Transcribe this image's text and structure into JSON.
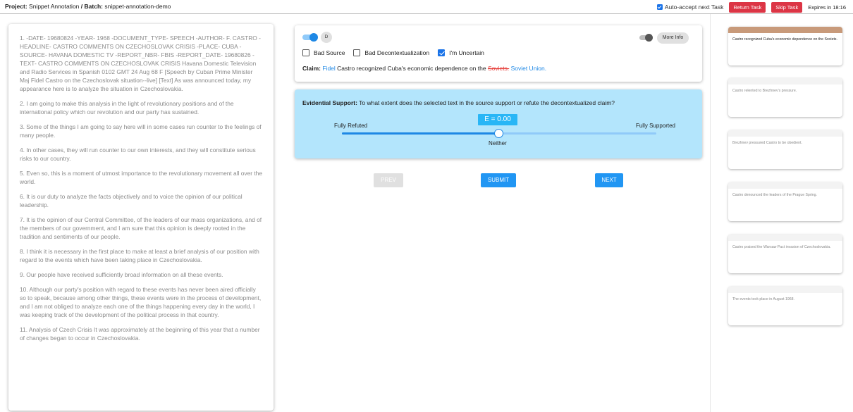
{
  "header": {
    "project_label": "Project:",
    "project_value": "Snippet Annotation",
    "batch_label": "Batch:",
    "batch_value": "snippet-annotation-demo",
    "auto_accept_label": "Auto-accept next Task",
    "auto_accept_checked": true,
    "return_task": "Return Task",
    "skip_task": "Skip Task",
    "expires": "Expires in 18:16"
  },
  "document": {
    "paragraphs": [
      "1. -DATE- 19680824 -YEAR- 1968 -DOCUMENT_TYPE- SPEECH -AUTHOR- F. CASTRO -HEADLINE- CASTRO COMMENTS ON CZECHOSLOVAK CRISIS -PLACE- CUBA -SOURCE- HAVANA DOMESTIC TV -REPORT_NBR- FBIS -REPORT_DATE- 19680826 -TEXT- CASTRO COMMENTS ON CZECHOSLOVAK CRISIS Havana Domestic Television and Radio Services in Spanish 0102 GMT 24 Aug 68 F [Speech by Cuban Prime Minister Maj Fidel Castro on the Czechoslovak situation--live] [Text] As was announced today, my appearance here is to analyze the situation in Czechoslovakia.",
      "2. I am going to make this analysis in the light of revolutionary positions and of the international policy which our revolution and our party has sustained.",
      "3. Some of the things I am going to say here will in some cases run counter to the feelings of many people.",
      "4. In other cases, they will run counter to our own interests, and they will constitute serious risks to our country.",
      "5. Even so, this is a moment of utmost importance to the revolutionary movement all over the world.",
      "6. It is our duty to analyze the facts objectively and to voice the opinion of our political leadership.",
      "7. It is the opinion of our Central Committee, of the leaders of our mass organizations, and of the members of our government, and I am sure that this opinion is deeply rooted in the tradition and sentiments of our people.",
      "8. I think it is necessary in the first place to make at least a brief analysis of our position with regard to the events which have been taking place in Czechoslovakia.",
      "9. Our people have received sufficiently broad information on all these events.",
      "10. Although our party's position with regard to these events has never been aired officially so to speak, because among other things, these events were in the process of development, and I am not obliged to analyze each one of the things happening every day in the world, I was keeping track of the development of the political process in that country.",
      "11. Analysis of Czech Crisis It was approximately at the beginning of this year that a number of changes began to occur in Czechoslovakia."
    ]
  },
  "claim_card": {
    "toggle_on": true,
    "badge": "D",
    "more_info_toggle_on": false,
    "more_info": "More Info",
    "checkboxes": [
      {
        "label": "Bad Source",
        "checked": false
      },
      {
        "label": "Bad Decontextualization",
        "checked": false
      },
      {
        "label": "I'm Uncertain",
        "checked": true
      }
    ],
    "claim_label": "Claim:",
    "claim_added_1": "Fidel",
    "claim_text_1": " Castro recognized Cuba's economic dependence on the ",
    "claim_removed": "Soviets.",
    "claim_added_2": " Soviet Union."
  },
  "evidence": {
    "question_label": "Evidential Support:",
    "question_text": " To what extent does the selected text in the source support or refute the decontextualized claim?",
    "left_label": "Fully Refuted",
    "right_label": "Fully Supported",
    "value_display": "E = 0.00",
    "value": 0.0,
    "range": [
      -1,
      1
    ],
    "center_label": "Neither"
  },
  "nav": {
    "prev": "PREV",
    "submit": "SUBMIT",
    "next": "NEXT"
  },
  "claims_list": [
    "Castro recognized Cuba's economic dependence on the Soviets.",
    "Castro relented to Brezhnev's pressure.",
    "Brezhnev pressured Castro to be obedient.",
    "Castro denounced the leaders of the Prague Spring.",
    "Castro praised the Warsaw Pact invasion of Czechoslovakia.",
    "The events took place in August 1968."
  ],
  "colors": {
    "accent": "#1e88e5",
    "danger": "#dc3545",
    "evidence_bg": "#b3e5fc",
    "selected_card_strip": "#c89a7a"
  }
}
